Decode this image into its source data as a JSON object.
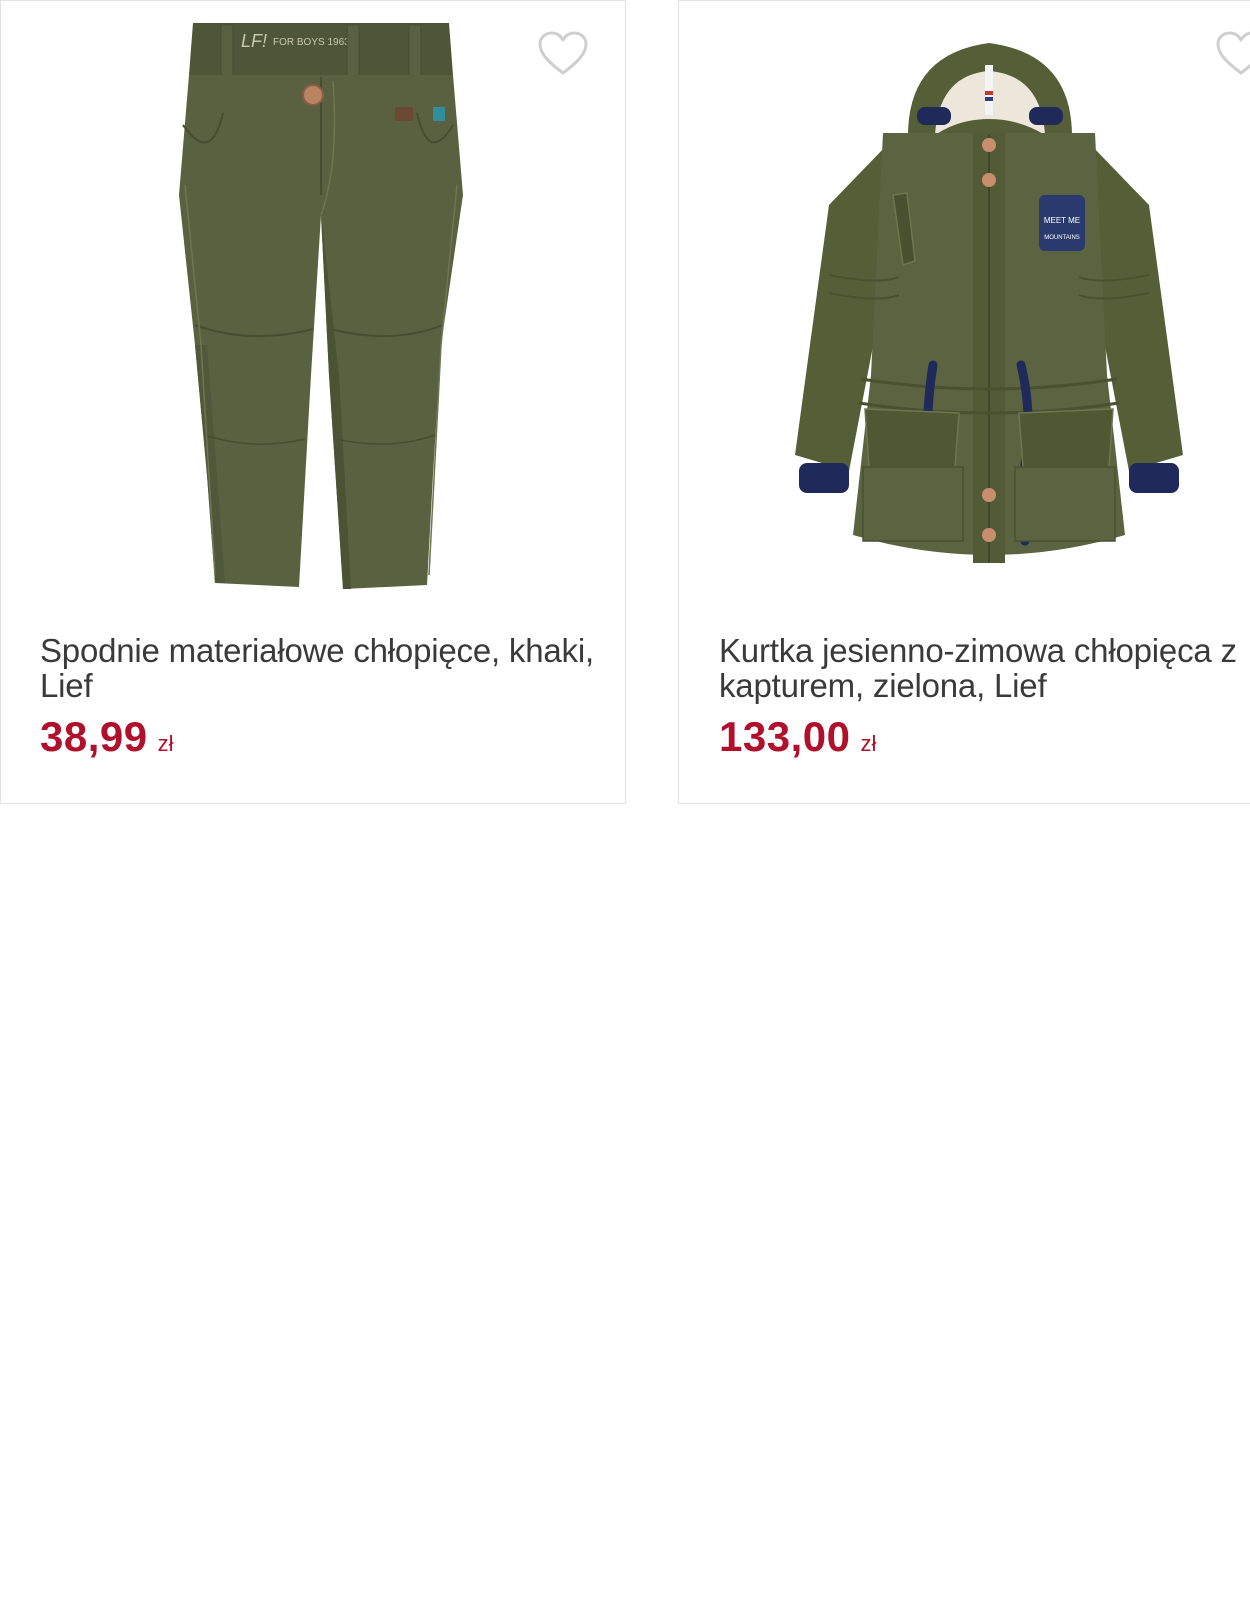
{
  "products": [
    {
      "title": "Spodnie materiałowe chłopięce, khaki, Lief",
      "price": "38,99",
      "currency": "zł",
      "image_icon": "khaki-trousers-image",
      "favorite_icon": "heart-outline-icon",
      "colors": {
        "garment": "#5a6140",
        "price": "#b0102c"
      }
    },
    {
      "title": "Kurtka jesienno-zimowa chłopięca z kapturem, zielona, Lief",
      "price": "133,00",
      "currency": "zł",
      "image_icon": "green-hooded-jacket-image",
      "favorite_icon": "heart-outline-icon",
      "colors": {
        "garment": "#565e38",
        "price": "#b0102c"
      }
    }
  ]
}
